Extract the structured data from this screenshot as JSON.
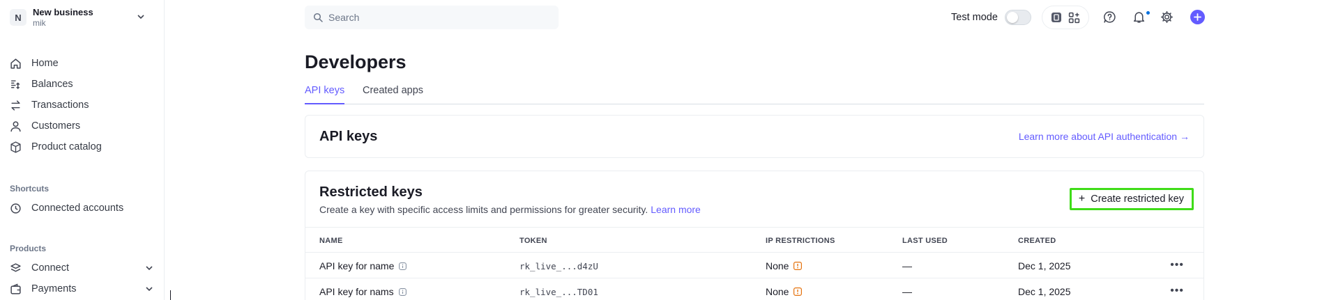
{
  "account": {
    "initial": "N",
    "name": "New business",
    "user": "mik"
  },
  "sidebar": {
    "items": [
      {
        "label": "Home"
      },
      {
        "label": "Balances"
      },
      {
        "label": "Transactions"
      },
      {
        "label": "Customers"
      },
      {
        "label": "Product catalog"
      }
    ],
    "shortcuts_label": "Shortcuts",
    "shortcuts": [
      {
        "label": "Connected accounts"
      }
    ],
    "products_label": "Products",
    "products": [
      {
        "label": "Connect"
      },
      {
        "label": "Payments"
      }
    ]
  },
  "topbar": {
    "search_placeholder": "Search",
    "test_mode_label": "Test mode",
    "test_mode_on": false
  },
  "page": {
    "title": "Developers",
    "tabs": [
      {
        "label": "API keys",
        "active": true
      },
      {
        "label": "Created apps",
        "active": false
      }
    ]
  },
  "api_keys_card": {
    "title": "API keys",
    "link": "Learn more about API authentication →"
  },
  "restricted_card": {
    "title": "Restricted keys",
    "description": "Create a key with specific access limits and permissions for greater security.",
    "learn_more": "Learn more",
    "create_button": "Create restricted key",
    "columns": {
      "name": "NAME",
      "token": "TOKEN",
      "ip": "IP RESTRICTIONS",
      "last_used": "LAST USED",
      "created": "CREATED"
    },
    "rows": [
      {
        "name": "API key for name",
        "token": "rk_live_...d4zU",
        "ip": "None",
        "last_used": "—",
        "created": "Dec 1, 2025"
      },
      {
        "name": "API key for nams",
        "token": "rk_live_...TD01",
        "ip": "None",
        "last_used": "—",
        "created": "Dec 1, 2025"
      }
    ]
  },
  "colors": {
    "accent": "#635bff",
    "warning": "#e5720d",
    "highlight": "#3fdc18"
  }
}
